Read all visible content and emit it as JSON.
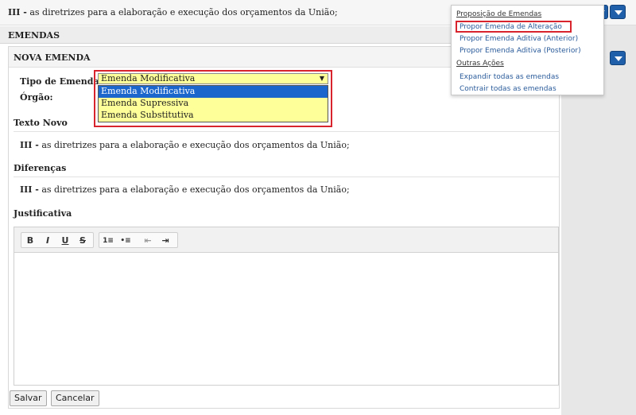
{
  "top": {
    "prefix": "III -",
    "text": "as diretrizes para a elaboração e execução dos orçamentos da União;"
  },
  "emendas_header": "EMENDAS",
  "panel": {
    "title": "NOVA EMENDA",
    "tipo_label": "Tipo de Emenda",
    "orgao_label": "Órgão:",
    "select_value": "Emenda Modificativa",
    "options": [
      "Emenda Modificativa",
      "Emenda Supressiva",
      "Emenda Substitutiva"
    ],
    "texto_novo_label": "Texto Novo",
    "texto_novo_prefix": "III -",
    "texto_novo": "as diretrizes para a elaboração e execução dos orçamentos da União;",
    "diferencas_label": "Diferenças",
    "diferencas_prefix": "III -",
    "diferencas": "as diretrizes para a elaboração e execução dos orçamentos da União;",
    "justificativa_label": "Justificativa"
  },
  "editor": {
    "bold": "B",
    "italic": "I",
    "underline": "U",
    "strike": "S",
    "ordered_list": "1≡",
    "bullet_list": "•≡",
    "outdent": "⇤",
    "indent": "⇥"
  },
  "buttons": {
    "save": "Salvar",
    "cancel": "Cancelar"
  },
  "menu": {
    "section1": "Proposição de Emendas",
    "item1": "Propor Emenda de Alteração",
    "item2": "Propor Emenda Aditiva (Anterior)",
    "item3": "Propor Emenda Aditiva (Posterior)",
    "section2": "Outras Ações",
    "item4": "Expandir todas as emendas",
    "item5": "Contrair todas as emendas"
  },
  "colors": {
    "highlight_border": "#d8242c",
    "select_bg": "#ffff99",
    "selected_option": "#1a66cc",
    "toggle_blue": "#1f5ea8",
    "menu_link": "#2a5b9a"
  }
}
